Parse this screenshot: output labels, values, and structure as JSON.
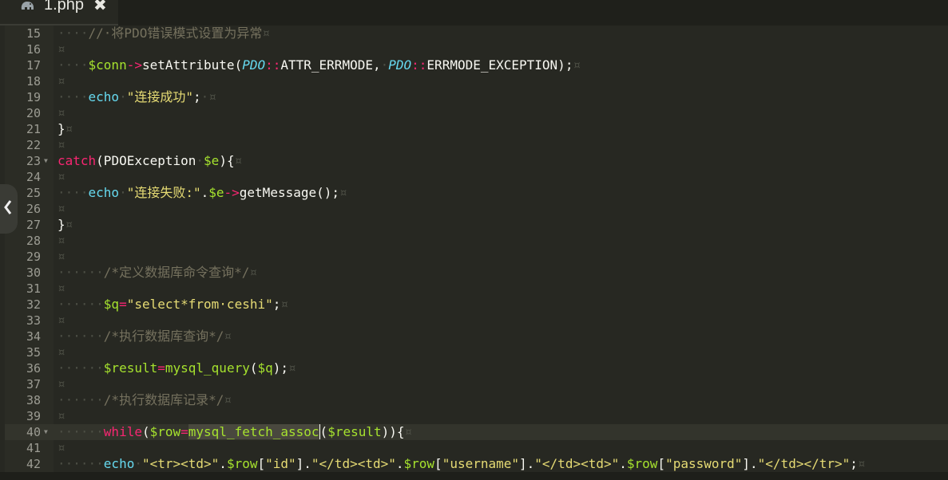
{
  "tab": {
    "icon": "php-elephant-icon",
    "label": "1.php",
    "close": "✖"
  },
  "editor": {
    "lines": [
      {
        "n": "15",
        "fold": false,
        "active": false,
        "tokens": [
          [
            "ws",
            "····"
          ],
          [
            "cm",
            "//·将PDO错误模式设置为异常"
          ],
          [
            "eol",
            "¤"
          ]
        ]
      },
      {
        "n": "16",
        "fold": false,
        "active": false,
        "tokens": [
          [
            "eol",
            "¤"
          ]
        ]
      },
      {
        "n": "17",
        "fold": false,
        "active": false,
        "tokens": [
          [
            "ws",
            "····"
          ],
          [
            "var",
            "$conn"
          ],
          [
            "op",
            "->"
          ],
          [
            "fn",
            "setAttribute("
          ],
          [
            "cls",
            "PDO"
          ],
          [
            "op",
            "::"
          ],
          [
            "plain",
            "ATTR_ERRMODE,"
          ],
          [
            "ws",
            "·"
          ],
          [
            "cls",
            "PDO"
          ],
          [
            "op",
            "::"
          ],
          [
            "plain",
            "ERRMODE_EXCEPTION);"
          ],
          [
            "eol",
            "¤"
          ]
        ]
      },
      {
        "n": "18",
        "fold": false,
        "active": false,
        "tokens": [
          [
            "eol",
            "¤"
          ]
        ]
      },
      {
        "n": "19",
        "fold": false,
        "active": false,
        "tokens": [
          [
            "ws",
            "····"
          ],
          [
            "kw",
            "echo"
          ],
          [
            "ws",
            "·"
          ],
          [
            "str",
            "\"连接成功\""
          ],
          [
            "plain",
            ";"
          ],
          [
            "ws",
            "·"
          ],
          [
            "eol",
            "¤"
          ]
        ]
      },
      {
        "n": "20",
        "fold": false,
        "active": false,
        "tokens": [
          [
            "eol",
            "¤"
          ]
        ]
      },
      {
        "n": "21",
        "fold": false,
        "active": false,
        "tokens": [
          [
            "plain",
            "}"
          ],
          [
            "eol",
            "¤"
          ]
        ]
      },
      {
        "n": "22",
        "fold": false,
        "active": false,
        "tokens": [
          [
            "eol",
            "¤"
          ]
        ]
      },
      {
        "n": "23",
        "fold": true,
        "active": false,
        "tokens": [
          [
            "ctl",
            "catch"
          ],
          [
            "plain",
            "(PDOException"
          ],
          [
            "ws",
            "·"
          ],
          [
            "var",
            "$e"
          ],
          [
            "plain",
            "){"
          ],
          [
            "eol",
            "¤"
          ]
        ]
      },
      {
        "n": "24",
        "fold": false,
        "active": false,
        "tokens": [
          [
            "eol",
            "¤"
          ]
        ]
      },
      {
        "n": "25",
        "fold": false,
        "active": false,
        "tokens": [
          [
            "ws",
            "····"
          ],
          [
            "kw",
            "echo"
          ],
          [
            "ws",
            "·"
          ],
          [
            "str",
            "\"连接失败:\""
          ],
          [
            "plain",
            "."
          ],
          [
            "var",
            "$e"
          ],
          [
            "op",
            "->"
          ],
          [
            "fn",
            "getMessage();"
          ],
          [
            "eol",
            "¤"
          ]
        ]
      },
      {
        "n": "26",
        "fold": false,
        "active": false,
        "tokens": [
          [
            "eol",
            "¤"
          ]
        ]
      },
      {
        "n": "27",
        "fold": false,
        "active": false,
        "tokens": [
          [
            "plain",
            "}"
          ],
          [
            "eol",
            "¤"
          ]
        ]
      },
      {
        "n": "28",
        "fold": false,
        "active": false,
        "tokens": [
          [
            "eol",
            "¤"
          ]
        ]
      },
      {
        "n": "29",
        "fold": false,
        "active": false,
        "tokens": [
          [
            "eol",
            "¤"
          ]
        ]
      },
      {
        "n": "30",
        "fold": false,
        "active": false,
        "tokens": [
          [
            "ws",
            "······"
          ],
          [
            "cm",
            "/*定义数据库命令查询*/"
          ],
          [
            "eol",
            "¤"
          ]
        ]
      },
      {
        "n": "31",
        "fold": false,
        "active": false,
        "tokens": [
          [
            "eol",
            "¤"
          ]
        ]
      },
      {
        "n": "32",
        "fold": false,
        "active": false,
        "tokens": [
          [
            "ws",
            "······"
          ],
          [
            "var",
            "$q"
          ],
          [
            "op",
            "="
          ],
          [
            "str",
            "\"select*from·ceshi\""
          ],
          [
            "plain",
            ";"
          ],
          [
            "eol",
            "¤"
          ]
        ]
      },
      {
        "n": "33",
        "fold": false,
        "active": false,
        "tokens": [
          [
            "eol",
            "¤"
          ]
        ]
      },
      {
        "n": "34",
        "fold": false,
        "active": false,
        "tokens": [
          [
            "ws",
            "······"
          ],
          [
            "cm",
            "/*执行数据库查询*/"
          ],
          [
            "eol",
            "¤"
          ]
        ]
      },
      {
        "n": "35",
        "fold": false,
        "active": false,
        "tokens": [
          [
            "eol",
            "¤"
          ]
        ]
      },
      {
        "n": "36",
        "fold": false,
        "active": false,
        "tokens": [
          [
            "ws",
            "······"
          ],
          [
            "var",
            "$result"
          ],
          [
            "op",
            "="
          ],
          [
            "var",
            "mysql_query"
          ],
          [
            "plain",
            "("
          ],
          [
            "var",
            "$q"
          ],
          [
            "plain",
            ");"
          ],
          [
            "eol",
            "¤"
          ]
        ]
      },
      {
        "n": "37",
        "fold": false,
        "active": false,
        "tokens": [
          [
            "eol",
            "¤"
          ]
        ]
      },
      {
        "n": "38",
        "fold": false,
        "active": false,
        "tokens": [
          [
            "ws",
            "······"
          ],
          [
            "cm",
            "/*执行数据库记录*/"
          ],
          [
            "eol",
            "¤"
          ]
        ]
      },
      {
        "n": "39",
        "fold": false,
        "active": false,
        "tokens": [
          [
            "eol",
            "¤"
          ]
        ]
      },
      {
        "n": "40",
        "fold": true,
        "active": true,
        "tokens": [
          [
            "ws",
            "······"
          ],
          [
            "ctl",
            "while"
          ],
          [
            "plain",
            "("
          ],
          [
            "var",
            "$row"
          ],
          [
            "op",
            "="
          ],
          [
            "var sel",
            "mysql_fetch_assoc"
          ],
          [
            "plain caret",
            "("
          ],
          [
            "var",
            "$result"
          ],
          [
            "plain",
            ")){"
          ],
          [
            "eol",
            "¤"
          ]
        ]
      },
      {
        "n": "41",
        "fold": false,
        "active": false,
        "tokens": [
          [
            "eol",
            "¤"
          ]
        ]
      },
      {
        "n": "42",
        "fold": false,
        "active": false,
        "tokens": [
          [
            "ws",
            "······"
          ],
          [
            "kw",
            "echo"
          ],
          [
            "ws",
            "·"
          ],
          [
            "str",
            "\"<tr><td>\""
          ],
          [
            "plain",
            "."
          ],
          [
            "var",
            "$row"
          ],
          [
            "plain",
            "["
          ],
          [
            "str",
            "\"id\""
          ],
          [
            "plain",
            "]."
          ],
          [
            "str",
            "\"</td><td>\""
          ],
          [
            "plain",
            "."
          ],
          [
            "var",
            "$row"
          ],
          [
            "plain",
            "["
          ],
          [
            "str",
            "\"username\""
          ],
          [
            "plain",
            "]."
          ],
          [
            "str",
            "\"</td><td>\""
          ],
          [
            "plain",
            "."
          ],
          [
            "var",
            "$row"
          ],
          [
            "plain",
            "["
          ],
          [
            "str",
            "\"password\""
          ],
          [
            "plain",
            "]."
          ],
          [
            "str",
            "\"</td></tr>\""
          ],
          [
            "plain",
            ";"
          ],
          [
            "eol",
            "¤"
          ]
        ]
      }
    ]
  },
  "sidebar_toggle": {
    "icon": "chevron-left-icon",
    "glyph": "‹"
  }
}
